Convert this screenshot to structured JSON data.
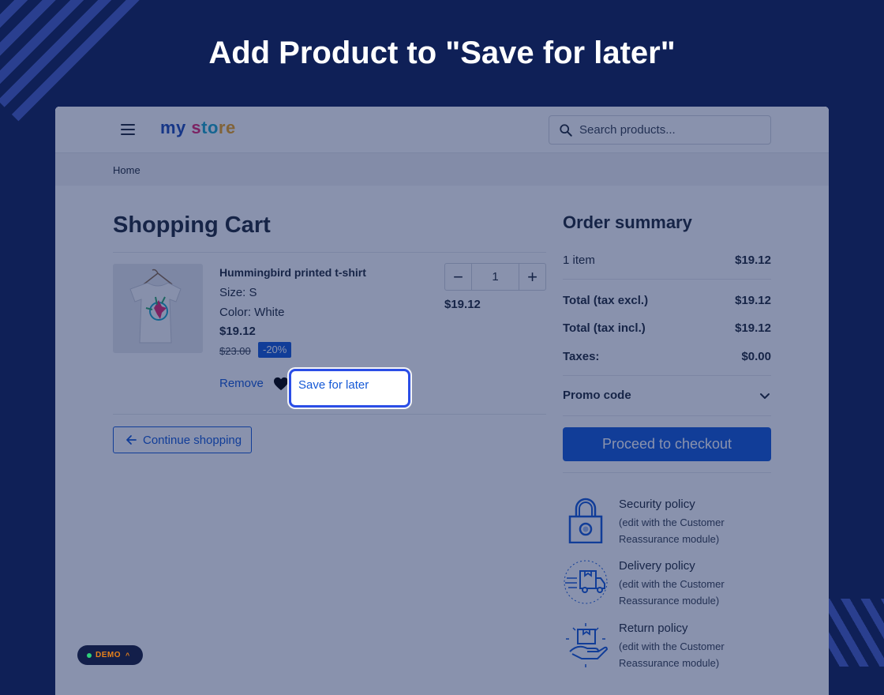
{
  "heading": "Add Product to \"Save for later\"",
  "header": {
    "logo": {
      "part1": "my",
      "part2": " s",
      "part3": "to",
      "part4": "re"
    },
    "search_placeholder": "Search products..."
  },
  "breadcrumb": "Home",
  "cart": {
    "title": "Shopping Cart",
    "product": {
      "name": "Hummingbird printed t-shirt",
      "size": "Size: S",
      "color": "Color: White",
      "price": "$19.12",
      "old_price": "$23.00",
      "discount": "-20%",
      "quantity": "1",
      "line_total": "$19.12"
    },
    "remove_label": "Remove",
    "save_for_later_label": "Save for later",
    "continue_label": "Continue shopping"
  },
  "summary": {
    "title": "Order summary",
    "items_label": "1 item",
    "items_value": "$19.12",
    "total_excl_label": "Total (tax excl.)",
    "total_excl_value": "$19.12",
    "total_incl_label": "Total (tax incl.)",
    "total_incl_value": "$19.12",
    "taxes_label": "Taxes:",
    "taxes_value": "$0.00",
    "promo_label": "Promo code",
    "checkout_label": "Proceed to checkout"
  },
  "reassurance": [
    {
      "title": "Security policy",
      "desc": "(edit with the Customer Reassurance module)",
      "icon": "lock-icon"
    },
    {
      "title": "Delivery policy",
      "desc": "(edit with the Customer Reassurance module)",
      "icon": "delivery-truck-icon"
    },
    {
      "title": "Return policy",
      "desc": "(edit with the Customer Reassurance module)",
      "icon": "return-box-icon"
    }
  ],
  "demo_badge": "DEMO",
  "colors": {
    "background": "#0f2057",
    "accent": "#1559d6",
    "highlight": "#2b4ee6"
  }
}
